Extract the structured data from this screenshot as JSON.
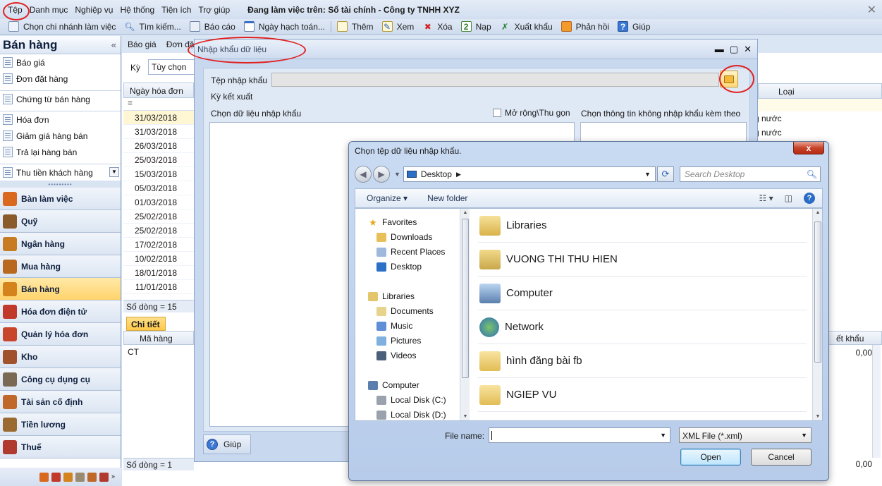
{
  "menu": {
    "items": [
      "Tệp",
      "Danh mục",
      "Nghiệp vụ",
      "Hệ thống",
      "Tiện ích",
      "Trợ giúp"
    ],
    "working_on": "Đang làm việc trên: Sổ tài chính - Công ty TNHH XYZ"
  },
  "toolbar": {
    "branch": "Chọn chi nhánh làm việc",
    "search": "Tìm kiếm...",
    "report": "Báo cáo",
    "posting_date": "Ngày hạch toán...",
    "add": "Thêm",
    "view": "Xem",
    "delete": "Xóa",
    "load": "Nạp",
    "export": "Xuất khẩu",
    "feedback": "Phản hồi",
    "help": "Giúp"
  },
  "sidebar": {
    "title": "Bán hàng",
    "sub_items": [
      "Báo giá",
      "Đơn đặt hàng",
      "Chứng từ bán hàng",
      "Hóa đơn",
      "Giảm giá hàng bán",
      "Trả lại hàng bán",
      "Thu tiền khách hàng"
    ],
    "modules": [
      {
        "label": "Bàn làm việc",
        "icon": "desk-icon",
        "color": "#d9691e"
      },
      {
        "label": "Quỹ",
        "icon": "safe-icon",
        "color": "#8a5a2b"
      },
      {
        "label": "Ngân hàng",
        "icon": "bank-icon",
        "color": "#c77b22"
      },
      {
        "label": "Mua hàng",
        "icon": "cart-icon",
        "color": "#b8691e"
      },
      {
        "label": "Bán hàng",
        "icon": "sales-icon",
        "color": "#d4831d"
      },
      {
        "label": "Hóa đơn điện tử",
        "icon": "einvoice-icon",
        "color": "#c0392b"
      },
      {
        "label": "Quản lý hóa đơn",
        "icon": "invoice-manage-icon",
        "color": "#c8442b"
      },
      {
        "label": "Kho",
        "icon": "warehouse-icon",
        "color": "#a0522d"
      },
      {
        "label": "Công cụ dụng cụ",
        "icon": "tools-icon",
        "color": "#7a6a55"
      },
      {
        "label": "Tài sản cố định",
        "icon": "asset-icon",
        "color": "#c0682a"
      },
      {
        "label": "Tiền lương",
        "icon": "salary-icon",
        "color": "#9a6a30"
      },
      {
        "label": "Thuế",
        "icon": "tax-icon",
        "color": "#b03a2e"
      }
    ]
  },
  "main": {
    "tabs": [
      "Báo giá",
      "Đơn đặt"
    ],
    "ky_label": "Kỳ",
    "ky_value": "Tùy chọn",
    "col_date": "Ngày hóa đơn",
    "filter_sign": "=",
    "dates": [
      "31/03/2018",
      "31/03/2018",
      "26/03/2018",
      "25/03/2018",
      "15/03/2018",
      "05/03/2018",
      "01/03/2018",
      "25/02/2018",
      "25/02/2018",
      "17/02/2018",
      "10/02/2018",
      "18/01/2018",
      "11/01/2018"
    ],
    "row_count_top": "Số dòng = 15",
    "detail_tab": "Chi tiết",
    "col_item_code": "Mã hàng",
    "item_row": "CT",
    "row_count_bottom": "Số dòng = 1",
    "right_col_type": "Loại",
    "right_rows": [
      "g nước",
      "g nước"
    ],
    "right_col_export": "ết khẩu",
    "right_values": [
      "0,00",
      "0,00"
    ]
  },
  "import_dialog": {
    "title": "Nhập khẩu dữ liệu",
    "file_label": "Tệp nhập khẩu",
    "period_label": "Kỳ kết xuất",
    "choose_data_label": "Chọn dữ liệu nhập khẩu",
    "expand_label": "Mở rộng\\Thu gọn",
    "choose_info_label": "Chọn thông tin không nhập khẩu kèm theo",
    "help_label": "Giúp"
  },
  "file_dialog": {
    "title": "Chọn tệp dữ liệu nhập khẩu.",
    "close": "x",
    "address": "Desktop",
    "search_placeholder": "Search Desktop",
    "organize": "Organize",
    "new_folder": "New folder",
    "tree": {
      "favorites": "Favorites",
      "downloads": "Downloads",
      "recent": "Recent Places",
      "desktop": "Desktop",
      "libraries": "Libraries",
      "documents": "Documents",
      "music": "Music",
      "pictures": "Pictures",
      "videos": "Videos",
      "computer": "Computer",
      "disk_c": "Local Disk (C:)",
      "disk_d": "Local Disk (D:)"
    },
    "items": [
      "Libraries",
      "VUONG THI THU HIEN",
      "Computer",
      "Network",
      "hình đăng bài fb",
      "NGIEP VU"
    ],
    "file_name_label": "File name:",
    "file_name_value": "",
    "file_type": "XML File (*.xml)",
    "open": "Open",
    "cancel": "Cancel"
  }
}
